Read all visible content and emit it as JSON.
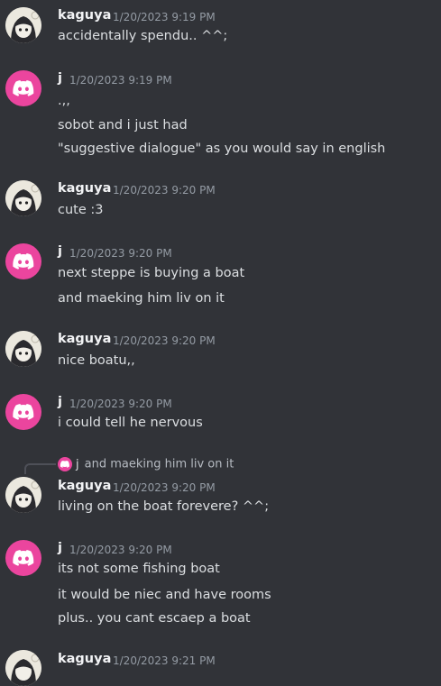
{
  "colors": {
    "background": "#313338",
    "username": "#f2f3f5",
    "text": "#dbdee1",
    "timestamp": "#949ba4",
    "discord_avatar": "#eb459e"
  },
  "messages": [
    {
      "author": "kaguya",
      "avatar": "anime-girl-avatar",
      "timestamp": "1/20/2023 9:19 PM",
      "lines": [
        "accidentally spendu.. ^^;"
      ]
    },
    {
      "author": "j",
      "avatar": "discord-logo-icon",
      "timestamp": "1/20/2023 9:19 PM",
      "lines": [
        ".,,",
        "sobot and i just had",
        "\"suggestive dialogue\" as you would say in english"
      ]
    },
    {
      "author": "kaguya",
      "avatar": "anime-girl-avatar",
      "timestamp": "1/20/2023 9:20 PM",
      "lines": [
        "cute :3"
      ]
    },
    {
      "author": "j",
      "avatar": "discord-logo-icon",
      "timestamp": "1/20/2023 9:20 PM",
      "lines": [
        "next steppe is buying a boat",
        "and maeking him liv on it"
      ]
    },
    {
      "author": "kaguya",
      "avatar": "anime-girl-avatar",
      "timestamp": "1/20/2023 9:20 PM",
      "lines": [
        "nice boatu,,"
      ]
    },
    {
      "author": "j",
      "avatar": "discord-logo-icon",
      "timestamp": "1/20/2023 9:20 PM",
      "lines": [
        "i could tell he nervous"
      ]
    },
    {
      "author": "kaguya",
      "avatar": "anime-girl-avatar",
      "timestamp": "1/20/2023 9:20 PM",
      "reply": {
        "author": "j",
        "text": "and maeking him liv on it"
      },
      "lines": [
        "living on the boat forevere? ^^;"
      ]
    },
    {
      "author": "j",
      "avatar": "discord-logo-icon",
      "timestamp": "1/20/2023 9:20 PM",
      "lines": [
        "its not some fishing boat",
        "it would be niec and have rooms",
        "plus.. you cant escaep a boat"
      ]
    },
    {
      "author": "kaguya",
      "avatar": "anime-girl-avatar",
      "timestamp": "1/20/2023 9:21 PM",
      "lines": []
    }
  ]
}
